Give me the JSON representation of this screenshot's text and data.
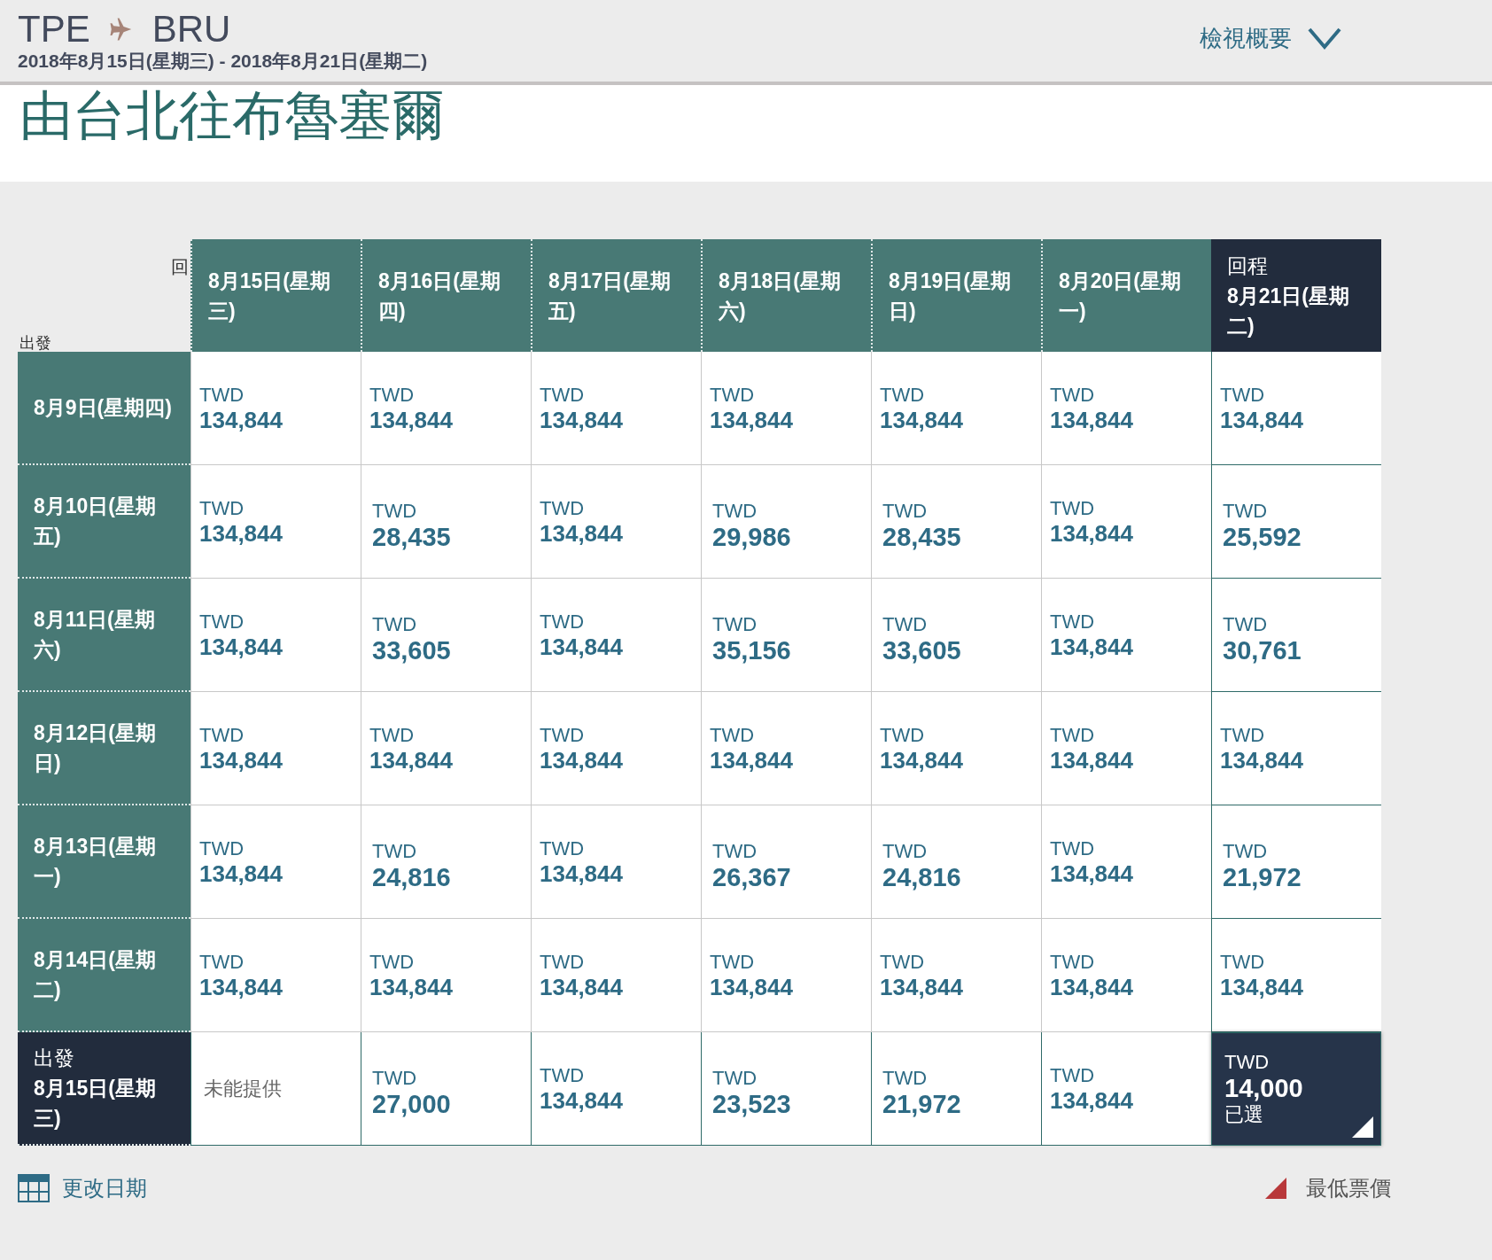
{
  "header": {
    "origin": "TPE",
    "destination": "BRU",
    "dates": "2018年8月15日(星期三) - 2018年8月21日(星期二)",
    "summary_link": "檢視概要"
  },
  "title": "由台北往布魯塞爾",
  "grid": {
    "return_axis_label": "回",
    "depart_axis_label": "出發",
    "columns": [
      {
        "label": "8月15日(星期三)",
        "selected": false
      },
      {
        "label": "8月16日(星期四)",
        "selected": false
      },
      {
        "label": "8月17日(星期五)",
        "selected": false
      },
      {
        "label": "8月18日(星期六)",
        "selected": false
      },
      {
        "label": "8月19日(星期日)",
        "selected": false
      },
      {
        "label": "8月20日(星期一)",
        "selected": false
      },
      {
        "label": "8月21日(星期二)",
        "selected": true,
        "caption": "回程"
      }
    ],
    "rows": [
      {
        "label": "8月9日(星期四)",
        "selected": false,
        "cells": [
          {
            "kind": "fare",
            "currency": "TWD",
            "price": "134,844",
            "selected": false
          },
          {
            "kind": "fare",
            "currency": "TWD",
            "price": "134,844",
            "selected": false
          },
          {
            "kind": "fare",
            "currency": "TWD",
            "price": "134,844",
            "selected": false
          },
          {
            "kind": "fare",
            "currency": "TWD",
            "price": "134,844",
            "selected": false
          },
          {
            "kind": "fare",
            "currency": "TWD",
            "price": "134,844",
            "selected": false
          },
          {
            "kind": "fare",
            "currency": "TWD",
            "price": "134,844",
            "selected": false
          },
          {
            "kind": "fare",
            "currency": "TWD",
            "price": "134,844",
            "selected": false
          }
        ]
      },
      {
        "label": "8月10日(星期五)",
        "selected": false,
        "cells": [
          {
            "kind": "fare",
            "currency": "TWD",
            "price": "134,844",
            "selected": false
          },
          {
            "kind": "fare_large",
            "currency": "TWD",
            "price": "28,435",
            "selected": false
          },
          {
            "kind": "fare",
            "currency": "TWD",
            "price": "134,844",
            "selected": false
          },
          {
            "kind": "fare_large",
            "currency": "TWD",
            "price": "29,986",
            "selected": false
          },
          {
            "kind": "fare_large",
            "currency": "TWD",
            "price": "28,435",
            "selected": false
          },
          {
            "kind": "fare",
            "currency": "TWD",
            "price": "134,844",
            "selected": false
          },
          {
            "kind": "fare_large",
            "currency": "TWD",
            "price": "25,592",
            "selected": false
          }
        ]
      },
      {
        "label": "8月11日(星期六)",
        "selected": false,
        "cells": [
          {
            "kind": "fare",
            "currency": "TWD",
            "price": "134,844",
            "selected": false
          },
          {
            "kind": "fare_large",
            "currency": "TWD",
            "price": "33,605",
            "selected": false
          },
          {
            "kind": "fare",
            "currency": "TWD",
            "price": "134,844",
            "selected": false
          },
          {
            "kind": "fare_large",
            "currency": "TWD",
            "price": "35,156",
            "selected": false
          },
          {
            "kind": "fare_large",
            "currency": "TWD",
            "price": "33,605",
            "selected": false
          },
          {
            "kind": "fare",
            "currency": "TWD",
            "price": "134,844",
            "selected": false
          },
          {
            "kind": "fare_large",
            "currency": "TWD",
            "price": "30,761",
            "selected": false
          }
        ]
      },
      {
        "label": "8月12日(星期日)",
        "selected": false,
        "cells": [
          {
            "kind": "fare",
            "currency": "TWD",
            "price": "134,844",
            "selected": false
          },
          {
            "kind": "fare",
            "currency": "TWD",
            "price": "134,844",
            "selected": false
          },
          {
            "kind": "fare",
            "currency": "TWD",
            "price": "134,844",
            "selected": false
          },
          {
            "kind": "fare",
            "currency": "TWD",
            "price": "134,844",
            "selected": false
          },
          {
            "kind": "fare",
            "currency": "TWD",
            "price": "134,844",
            "selected": false
          },
          {
            "kind": "fare",
            "currency": "TWD",
            "price": "134,844",
            "selected": false
          },
          {
            "kind": "fare",
            "currency": "TWD",
            "price": "134,844",
            "selected": false
          }
        ]
      },
      {
        "label": "8月13日(星期一)",
        "selected": false,
        "cells": [
          {
            "kind": "fare",
            "currency": "TWD",
            "price": "134,844",
            "selected": false
          },
          {
            "kind": "fare_large",
            "currency": "TWD",
            "price": "24,816",
            "selected": false
          },
          {
            "kind": "fare",
            "currency": "TWD",
            "price": "134,844",
            "selected": false
          },
          {
            "kind": "fare_large",
            "currency": "TWD",
            "price": "26,367",
            "selected": false
          },
          {
            "kind": "fare_large",
            "currency": "TWD",
            "price": "24,816",
            "selected": false
          },
          {
            "kind": "fare",
            "currency": "TWD",
            "price": "134,844",
            "selected": false
          },
          {
            "kind": "fare_large",
            "currency": "TWD",
            "price": "21,972",
            "selected": false
          }
        ]
      },
      {
        "label": "8月14日(星期二)",
        "selected": false,
        "cells": [
          {
            "kind": "fare",
            "currency": "TWD",
            "price": "134,844",
            "selected": false
          },
          {
            "kind": "fare",
            "currency": "TWD",
            "price": "134,844",
            "selected": false
          },
          {
            "kind": "fare",
            "currency": "TWD",
            "price": "134,844",
            "selected": false
          },
          {
            "kind": "fare",
            "currency": "TWD",
            "price": "134,844",
            "selected": false
          },
          {
            "kind": "fare",
            "currency": "TWD",
            "price": "134,844",
            "selected": false
          },
          {
            "kind": "fare",
            "currency": "TWD",
            "price": "134,844",
            "selected": false
          },
          {
            "kind": "fare",
            "currency": "TWD",
            "price": "134,844",
            "selected": false
          }
        ]
      },
      {
        "label": "8月15日(星期三)",
        "selected": true,
        "caption": "出發",
        "cells": [
          {
            "kind": "unavailable",
            "text": "未能提供",
            "selected": false
          },
          {
            "kind": "fare_large",
            "currency": "TWD",
            "price": "27,000",
            "selected": false
          },
          {
            "kind": "fare",
            "currency": "TWD",
            "price": "134,844",
            "selected": false
          },
          {
            "kind": "fare_large",
            "currency": "TWD",
            "price": "23,523",
            "selected": false
          },
          {
            "kind": "fare_large",
            "currency": "TWD",
            "price": "21,972",
            "selected": false
          },
          {
            "kind": "fare",
            "currency": "TWD",
            "price": "134,844",
            "selected": false
          },
          {
            "kind": "fare_large",
            "currency": "TWD",
            "price": "14,000",
            "selected": true,
            "status": "已選"
          }
        ]
      }
    ]
  },
  "footer": {
    "change_dates": "更改日期",
    "legend": "最低票價"
  }
}
